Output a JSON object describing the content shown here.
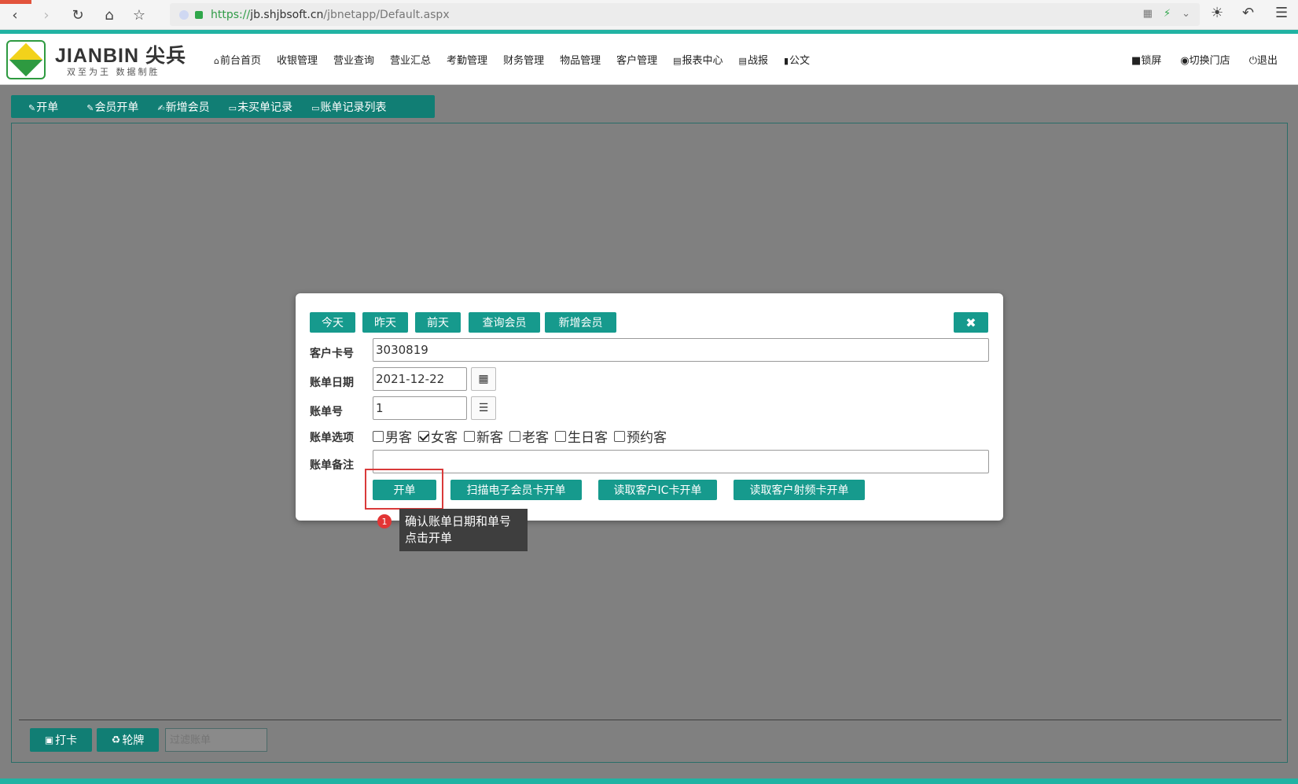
{
  "browser": {
    "url_scheme": "https://",
    "url_host": "jb.shjbsoft.cn",
    "url_path": "/jbnetapp/Default.aspx"
  },
  "header": {
    "brand": "JIANBIN 尖兵",
    "brand_sub": "双至为王  数据制胜",
    "nav": [
      "前台首页",
      "收银管理",
      "营业查询",
      "营业汇总",
      "考勤管理",
      "财务管理",
      "物品管理",
      "客户管理",
      "报表中心",
      "战报",
      "公文"
    ],
    "right_nav": [
      "锁屏",
      "切换门店",
      "退出"
    ]
  },
  "toolbar": {
    "items": [
      "开单",
      "会员开单",
      "新增会员",
      "未买单记录",
      "账单记录列表"
    ]
  },
  "bottom": {
    "punch_label": "打卡",
    "rotate_label": "轮牌",
    "filter_placeholder": "过滤账单"
  },
  "dialog": {
    "quick_buttons": [
      "今天",
      "昨天",
      "前天",
      "查询会员",
      "新增会员"
    ],
    "close_icon": "close-icon",
    "fields": {
      "card_label": "客户卡号",
      "card_value": "3030819",
      "date_label": "账单日期",
      "date_value": "2021-12-22",
      "bill_no_label": "账单号",
      "bill_no_value": "1",
      "options_label": "账单选项",
      "remark_label": "账单备注",
      "remark_value": ""
    },
    "options": [
      {
        "label": "男客",
        "checked": false
      },
      {
        "label": "女客",
        "checked": true
      },
      {
        "label": "新客",
        "checked": false
      },
      {
        "label": "老客",
        "checked": false
      },
      {
        "label": "生日客",
        "checked": false
      },
      {
        "label": "预约客",
        "checked": false
      }
    ],
    "action_buttons": [
      "开单",
      "扫描电子会员卡开单",
      "读取客户IC卡开单",
      "读取客户射频卡开单"
    ]
  },
  "tooltip": {
    "number": "1",
    "line1": "确认账单日期和单号",
    "line2": "点击开单"
  },
  "colors": {
    "teal_dark": "#117e74",
    "teal_button": "#169a8d",
    "overlay_gray": "#808080",
    "highlight_red": "#d93a3a"
  }
}
